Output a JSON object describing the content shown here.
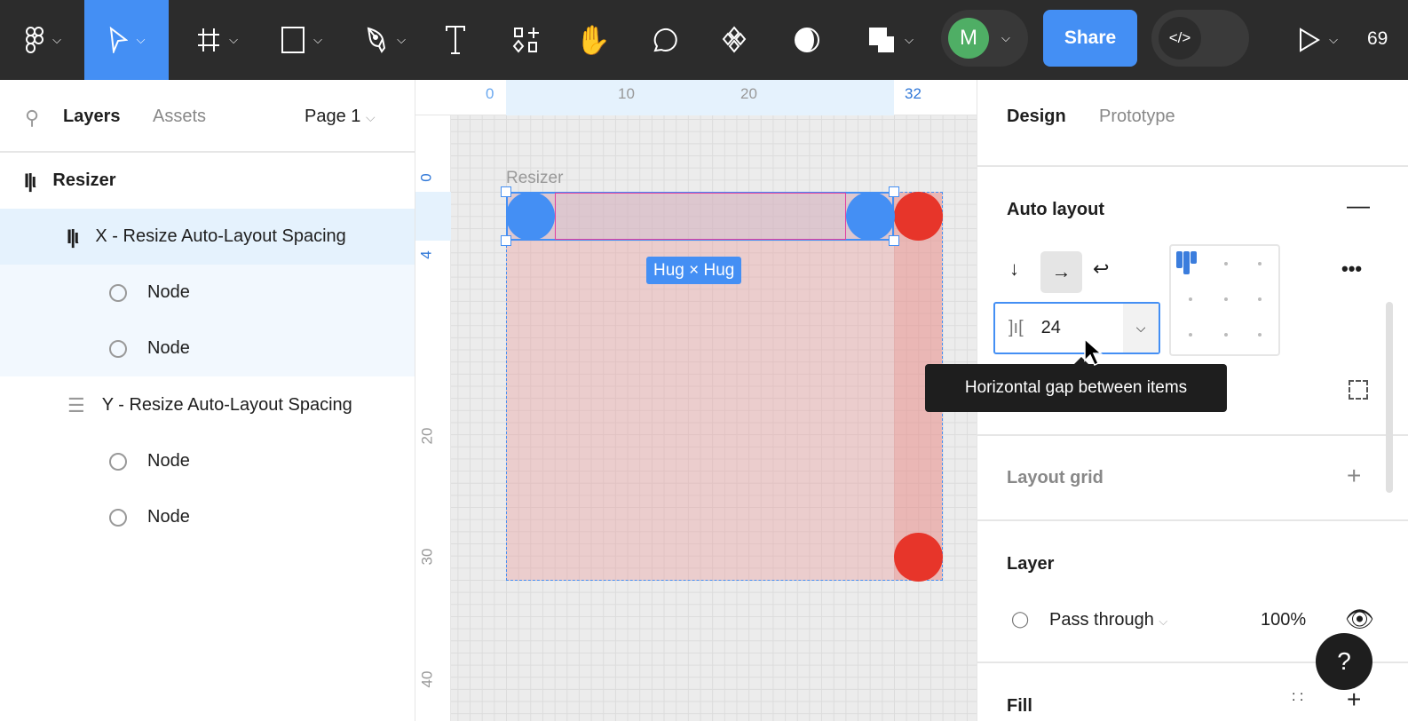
{
  "toolbar": {
    "share": "Share",
    "avatar": "M",
    "zoom": "69",
    "tools": [
      "main-menu",
      "move",
      "frame",
      "rectangle",
      "pen",
      "text",
      "components",
      "hand",
      "comment",
      "assets",
      "contrast",
      "boolean"
    ]
  },
  "left": {
    "tabs": {
      "layers": "Layers",
      "assets": "Assets"
    },
    "page": "Page 1",
    "layers": [
      {
        "name": "Resizer"
      },
      {
        "name": "X - Resize Auto-Layout Spacing"
      },
      {
        "name": "Node"
      },
      {
        "name": "Node"
      },
      {
        "name": "Y - Resize Auto-Layout Spacing"
      },
      {
        "name": "Node"
      },
      {
        "name": "Node"
      }
    ]
  },
  "canvas": {
    "frame_label": "Resizer",
    "size_badge": "Hug × Hug",
    "ruler_h": [
      "0",
      "10",
      "20",
      "32"
    ],
    "ruler_v": [
      "0",
      "4",
      "20",
      "30",
      "40"
    ]
  },
  "right": {
    "tabs": {
      "design": "Design",
      "prototype": "Prototype"
    },
    "auto_layout": {
      "title": "Auto layout",
      "gap": "24",
      "tooltip": "Horizontal gap between items"
    },
    "layout_grid": "Layout grid",
    "layer": {
      "title": "Layer",
      "blend": "Pass through",
      "opacity": "100%"
    },
    "fill": "Fill",
    "help": "?"
  },
  "colors": {
    "accent": "#448ff4",
    "red": "#e7352a",
    "avatar": "#4fae65"
  }
}
